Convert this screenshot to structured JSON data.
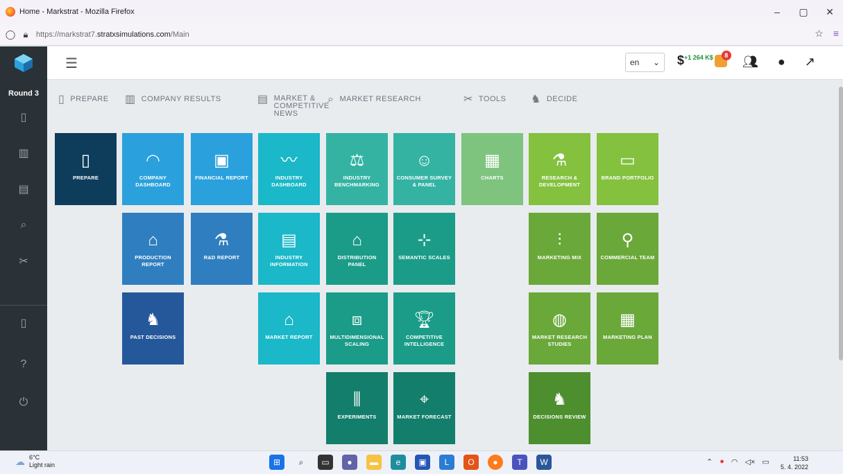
{
  "window": {
    "title": "Home - Markstrat - Mozilla Firefox",
    "controls": [
      "–",
      "▢",
      "✕"
    ]
  },
  "url": {
    "prefix": "https://markstrat7.",
    "domain": "stratxsimulations.com",
    "path": "/Main"
  },
  "header": {
    "language": "en",
    "cash_symbol": "$",
    "cash_value": "+1 264 K$",
    "badge_count": "8"
  },
  "sidebar": {
    "round": "Round 3"
  },
  "categories": [
    {
      "label": "PREPARE",
      "icon": "book-icon"
    },
    {
      "label": "COMPANY RESULTS",
      "icon": "building-icon"
    },
    {
      "label": "MARKET & COMPETITIVE NEWS",
      "icon": "newspaper-icon"
    },
    {
      "label": "MARKET RESEARCH",
      "icon": "search-icon"
    },
    {
      "label": "TOOLS",
      "icon": "tools-icon"
    },
    {
      "label": "DECIDE",
      "icon": "chess-knight-icon"
    }
  ],
  "tiles": {
    "prepare": "PREPARE",
    "company_dashboard": "COMPANY DASHBOARD",
    "financial_report": "FINANCIAL REPORT",
    "production_report": "PRODUCTION REPORT",
    "rd_report": "R&D REPORT",
    "past_decisions": "PAST DECISIONS",
    "industry_dashboard": "INDUSTRY DASHBOARD",
    "industry_information": "INDUSTRY INFORMATION",
    "market_report": "MARKET REPORT",
    "industry_benchmarking": "INDUSTRY BENCHMARKING",
    "consumer_survey": "CONSUMER SURVEY & PANEL",
    "distribution_panel": "DISTRIBUTION PANEL",
    "semantic_scales": "SEMANTIC SCALES",
    "multidimensional_scaling": "MULTIDIMENSIONAL SCALING",
    "competitive_intelligence": "COMPETITIVE INTELLIGENCE",
    "experiments": "EXPERIMENTS",
    "market_forecast": "MARKET FORECAST",
    "charts": "CHARTS",
    "research_development": "RESEARCH & DEVELOPMENT",
    "brand_portfolio": "BRAND PORTFOLIO",
    "marketing_mix": "MARKETING MIX",
    "commercial_team": "COMMERCIAL TEAM",
    "market_research_studies": "MARKET RESEARCH STUDIES",
    "marketing_plan": "MARKETING PLAN",
    "decisions_review": "DECISIONS REVIEW"
  },
  "colors": {
    "dark_navy": "#0e3d5c",
    "blue": "#2aa1dc",
    "mid_blue": "#2f7fc0",
    "deep_blue": "#25589a",
    "cyan": "#1ab8c8",
    "teal_light": "#34b3a3",
    "teal": "#1b9c88",
    "teal_dark": "#137e6b",
    "green_light": "#7ec47f",
    "lime": "#83c13e",
    "green": "#6aa83a",
    "green_dark": "#4d8f2f"
  },
  "taskbar": {
    "temp": "6°C",
    "weather": "Light rain",
    "time": "11:53",
    "date": "5. 4. 2022"
  }
}
